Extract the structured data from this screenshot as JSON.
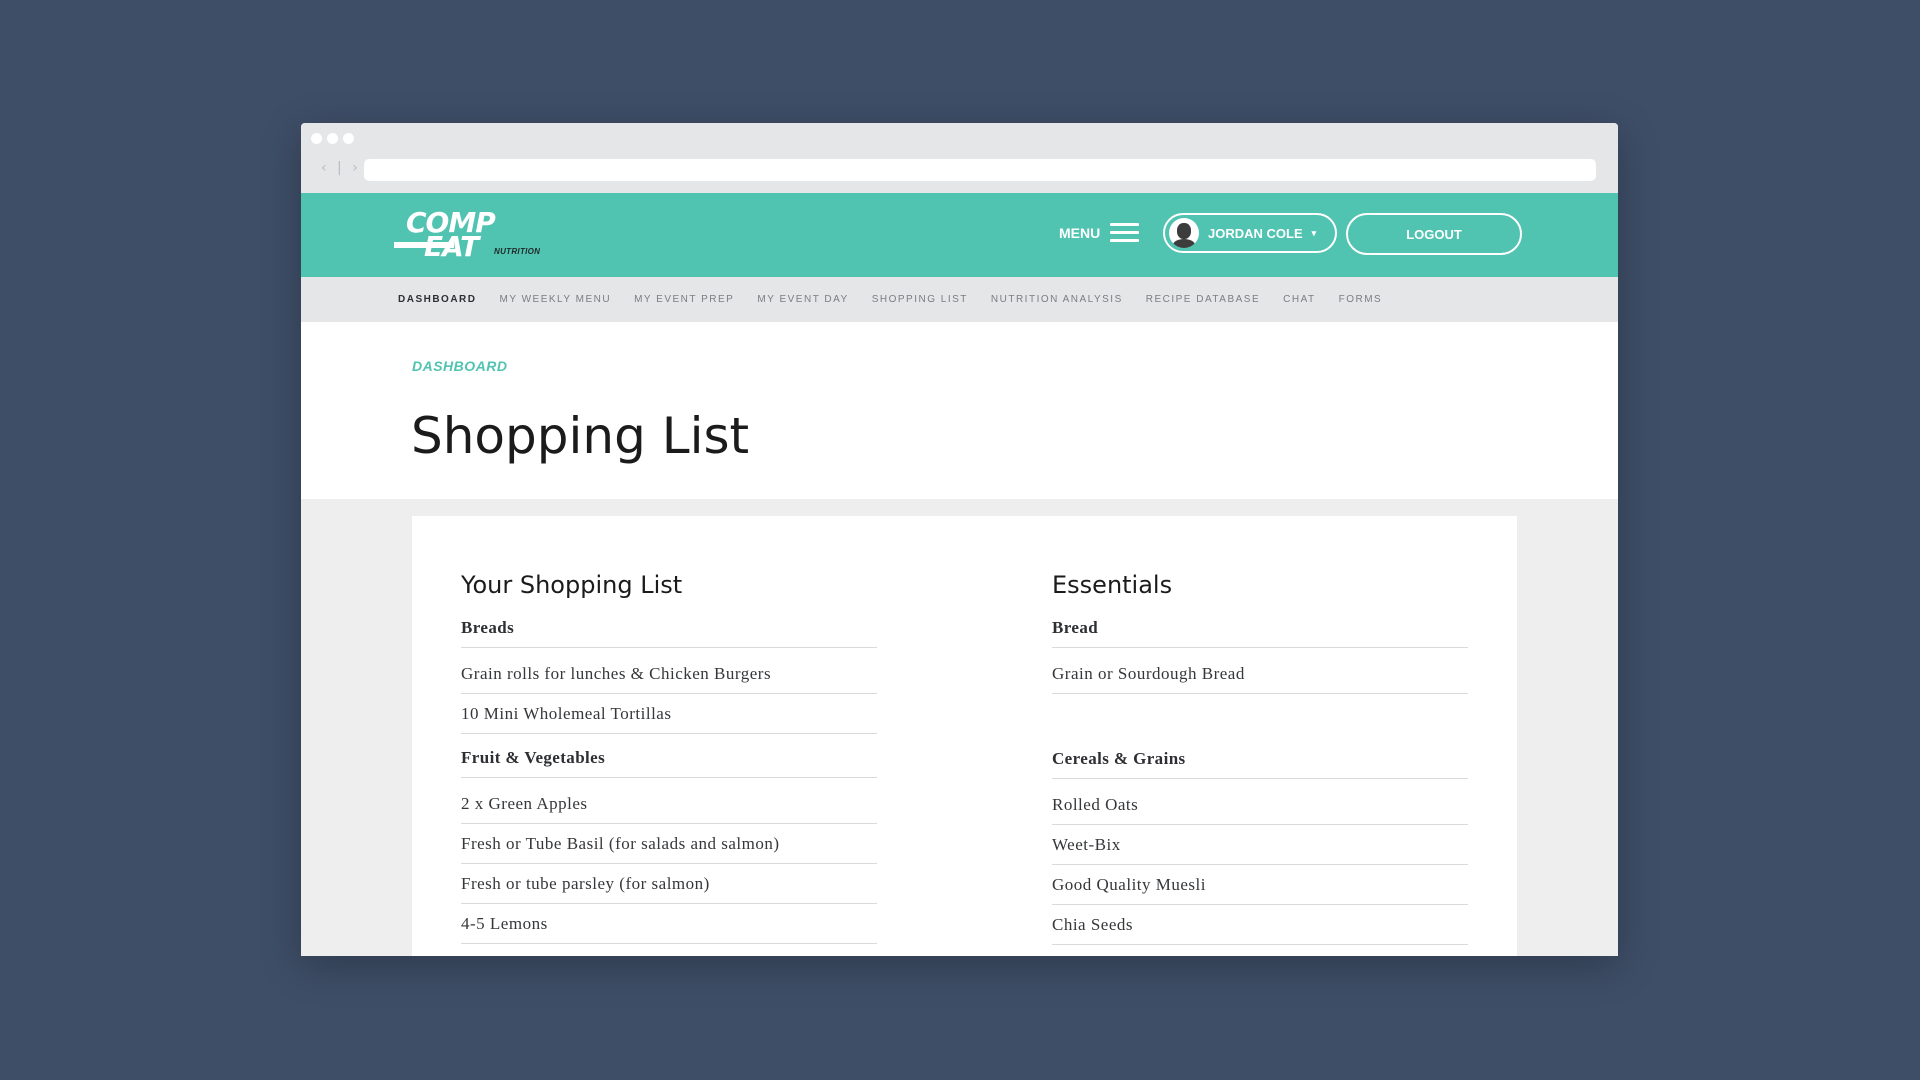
{
  "header": {
    "logo_line1": "COMP",
    "logo_line2": "EAT",
    "logo_sub": "NUTRITION",
    "menu_label": "MENU",
    "user_name": "JORDAN COLE",
    "logout_label": "LOGOUT"
  },
  "subnav": [
    {
      "label": "DASHBOARD",
      "active": true
    },
    {
      "label": "MY WEEKLY MENU",
      "active": false
    },
    {
      "label": "MY EVENT PREP",
      "active": false
    },
    {
      "label": "MY EVENT DAY",
      "active": false
    },
    {
      "label": "SHOPPING LIST",
      "active": false
    },
    {
      "label": "NUTRITION ANALYSIS",
      "active": false
    },
    {
      "label": "RECIPE DATABASE",
      "active": false
    },
    {
      "label": "CHAT",
      "active": false
    },
    {
      "label": "FORMS",
      "active": false
    }
  ],
  "page": {
    "breadcrumb": "DASHBOARD",
    "title": "Shopping List"
  },
  "shopping_list": {
    "heading": "Your Shopping List",
    "categories": [
      {
        "name": "Breads",
        "items": [
          "Grain rolls for lunches & Chicken Burgers",
          "10 Mini Wholemeal Tortillas"
        ]
      },
      {
        "name": "Fruit & Vegetables",
        "items": [
          "2 x Green Apples",
          "Fresh or Tube Basil (for salads and salmon)",
          "Fresh or tube parsley (for salmon)",
          "4-5 Lemons"
        ]
      }
    ]
  },
  "essentials": {
    "heading": "Essentials",
    "categories": [
      {
        "name": "Bread",
        "items": [
          "Grain or Sourdough Bread"
        ]
      },
      {
        "name": "Cereals & Grains",
        "items": [
          "Rolled Oats",
          "Weet-Bix",
          "Good Quality Muesli",
          "Chia Seeds"
        ]
      }
    ]
  },
  "colors": {
    "brand": "#51c3b1",
    "background": "#3e4e67"
  }
}
